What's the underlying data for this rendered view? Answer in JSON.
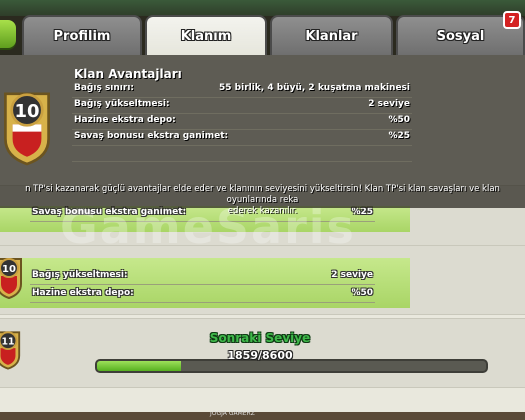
{
  "tabs": [
    {
      "label": "Profilim"
    },
    {
      "label": "Klanım"
    },
    {
      "label": "Klanlar"
    },
    {
      "label": "Sosyal"
    }
  ],
  "social_badge": "7",
  "overlay": {
    "title": "Klan Avantajları",
    "level": "10",
    "perks": [
      {
        "label": "Bağış sınırı:",
        "value": "55 birlik, 4 büyü, 2 kuşatma makinesi"
      },
      {
        "label": "Bağış yükseltmesi:",
        "value": "2 seviye"
      },
      {
        "label": "Hazine ekstra depo:",
        "value": "%50"
      },
      {
        "label": "Savaş bonusu ekstra ganimet:",
        "value": "%25"
      }
    ],
    "description_1": "n TP'si kazanarak güçlü avantajlar elde eder ve klanının seviyesini yükseltirsin! Klan TP'si klan savaşları ve klan oyunlarında reka",
    "description_2": "ederek kazanılır."
  },
  "rows": [
    {
      "level": "",
      "perks": [
        {
          "label": "Savaş bonusu ekstra ganimet:",
          "value": "%25"
        }
      ]
    },
    {
      "level": "10",
      "perks": [
        {
          "label": "Bağış yükseltmesi:",
          "value": "2 seviye"
        },
        {
          "label": "Hazine ekstra depo:",
          "value": "%50"
        }
      ]
    },
    {
      "level": "11",
      "perks": []
    }
  ],
  "next_level": {
    "title": "Sonraki Seviye",
    "count": "1859/8600",
    "progress": 0.216
  },
  "watermark": "GameSaris",
  "bottom_text": "JOGJA GAMERZ",
  "colors": {
    "accent_green": "#3fb84a",
    "badge_red": "#d42222"
  }
}
